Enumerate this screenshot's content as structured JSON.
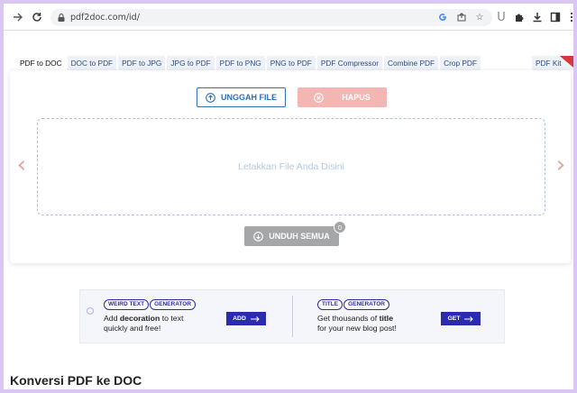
{
  "browser": {
    "url": "pdf2doc.com/id/",
    "icons": [
      "forward-icon",
      "reload-icon",
      "lock-icon",
      "google-icon",
      "share-icon",
      "star-icon",
      "extension-u-icon",
      "puzzle-icon",
      "download-icon",
      "sidepanel-icon",
      "menu-icon"
    ]
  },
  "tabs": [
    {
      "label": "PDF to DOC",
      "active": true
    },
    {
      "label": "DOC to PDF"
    },
    {
      "label": "PDF to JPG"
    },
    {
      "label": "JPG to PDF"
    },
    {
      "label": "PDF to PNG"
    },
    {
      "label": "PNG to PDF"
    },
    {
      "label": "PDF Compressor"
    },
    {
      "label": "Combine PDF"
    },
    {
      "label": "Crop PDF"
    }
  ],
  "tab_more": "PDF Kit",
  "converter": {
    "upload_label": "UNGGAH FILE",
    "delete_label": "HAPUS",
    "dropzone_text": "Letakkan File Anda Disini",
    "download_all_label": "UNDUH SEMUA",
    "file_count": "0"
  },
  "ad": {
    "left": {
      "tag1": "WEIRD TEXT",
      "tag2": "GENERATOR",
      "line1_pre": "Add ",
      "line1_bold": "decoration",
      "line1_post": " to text",
      "line2": "quickly and free!",
      "button": "ADD"
    },
    "right": {
      "tag1": "TITLE",
      "tag2": "GENERATOR",
      "line1_pre": "Get thousands of ",
      "line1_bold": "title",
      "line2": "for your new blog post!",
      "button": "GET"
    }
  },
  "page_heading": "Konversi PDF ke DOC",
  "colors": {
    "accent": "#2e6fb7",
    "delete_bg": "#f3b6b3",
    "disabled_bg": "#a4a6a8",
    "ad_button": "#2b2bb0",
    "frame": "#d9c6f2"
  }
}
